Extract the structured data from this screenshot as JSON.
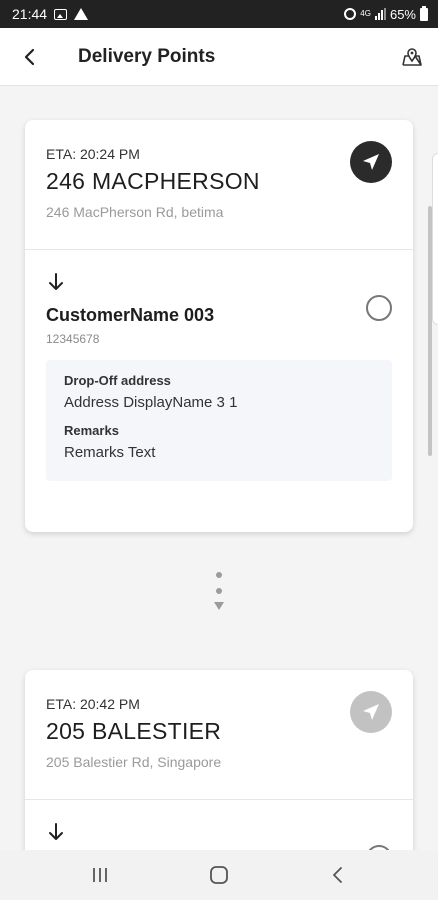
{
  "status_bar": {
    "time": "21:44",
    "battery": "65%",
    "network": "4G"
  },
  "header": {
    "title": "Delivery Points"
  },
  "stops": [
    {
      "eta": "ETA: 20:24 PM",
      "name": "246 MACPHERSON",
      "address": "246 MacPherson Rd, betima",
      "nav_active": true,
      "customer": {
        "name": "CustomerName 003",
        "phone": "12345678",
        "dropoff_label": "Drop-Off address",
        "dropoff_value": "Address DisplayName 3 1",
        "remarks_label": "Remarks",
        "remarks_value": "Remarks Text"
      }
    },
    {
      "eta": "ETA: 20:42 PM",
      "name": "205 BALESTIER",
      "address": "205 Balestier Rd, Singapore",
      "nav_active": false
    }
  ],
  "colors": {
    "nav_active": "#2b2b2b",
    "nav_inactive": "#c2c2c2",
    "detail_bg": "#f5f6fa"
  },
  "icons": [
    "back-arrow-icon",
    "map-icon",
    "navigation-icon",
    "arrow-down-icon",
    "radio-icon"
  ]
}
